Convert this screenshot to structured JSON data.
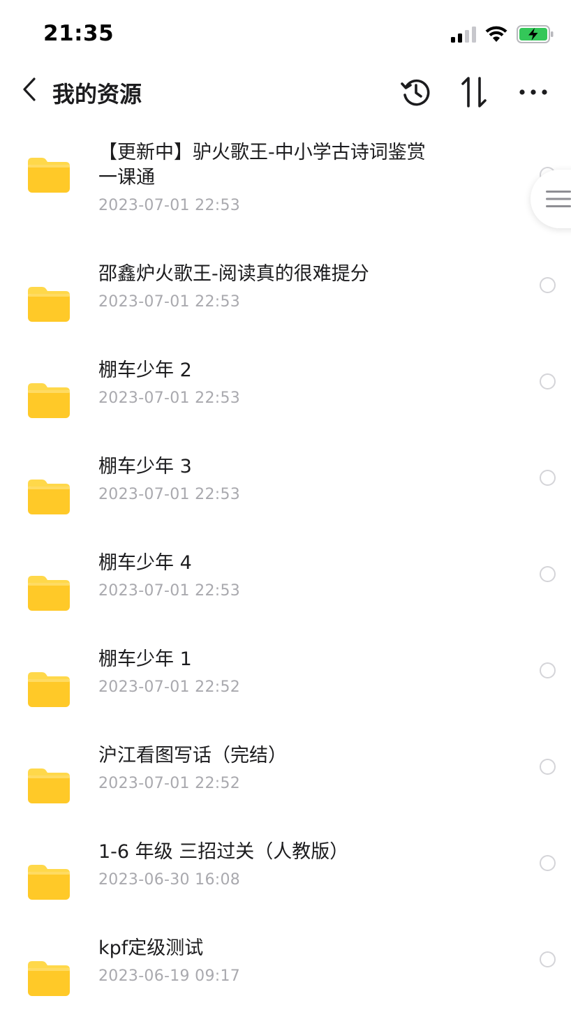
{
  "status_bar": {
    "time": "21:35",
    "icons": [
      "signal-icon",
      "wifi-icon",
      "battery-charging-icon"
    ],
    "battery_color": "#34c759"
  },
  "nav": {
    "title": "我的资源",
    "actions": [
      "history-icon",
      "sort-icon",
      "more-icon"
    ]
  },
  "files": [
    {
      "name_line1": "【更新中】驴火歌王-中小学古诗词鉴赏",
      "name_line2": "一课通",
      "date": "2023-07-01 22:53"
    },
    {
      "name": "邵鑫炉火歌王-阅读真的很难提分",
      "date": "2023-07-01 22:53"
    },
    {
      "name": "棚车少年 2",
      "date": "2023-07-01 22:53"
    },
    {
      "name": "棚车少年 3",
      "date": "2023-07-01 22:53"
    },
    {
      "name": "棚车少年 4",
      "date": "2023-07-01 22:53"
    },
    {
      "name": "棚车少年 1",
      "date": "2023-07-01 22:52"
    },
    {
      "name": "沪江看图写话（完结）",
      "date": "2023-07-01 22:52"
    },
    {
      "name": "1-6 年级 三招过关（人教版）",
      "date": "2023-06-30 16:08"
    },
    {
      "name": "kpf定级测试",
      "date": "2023-06-19 09:17"
    }
  ],
  "colors": {
    "folder_top": "#ffd84a",
    "folder_body": "#ffc928",
    "date_text": "#a9a9ae"
  }
}
